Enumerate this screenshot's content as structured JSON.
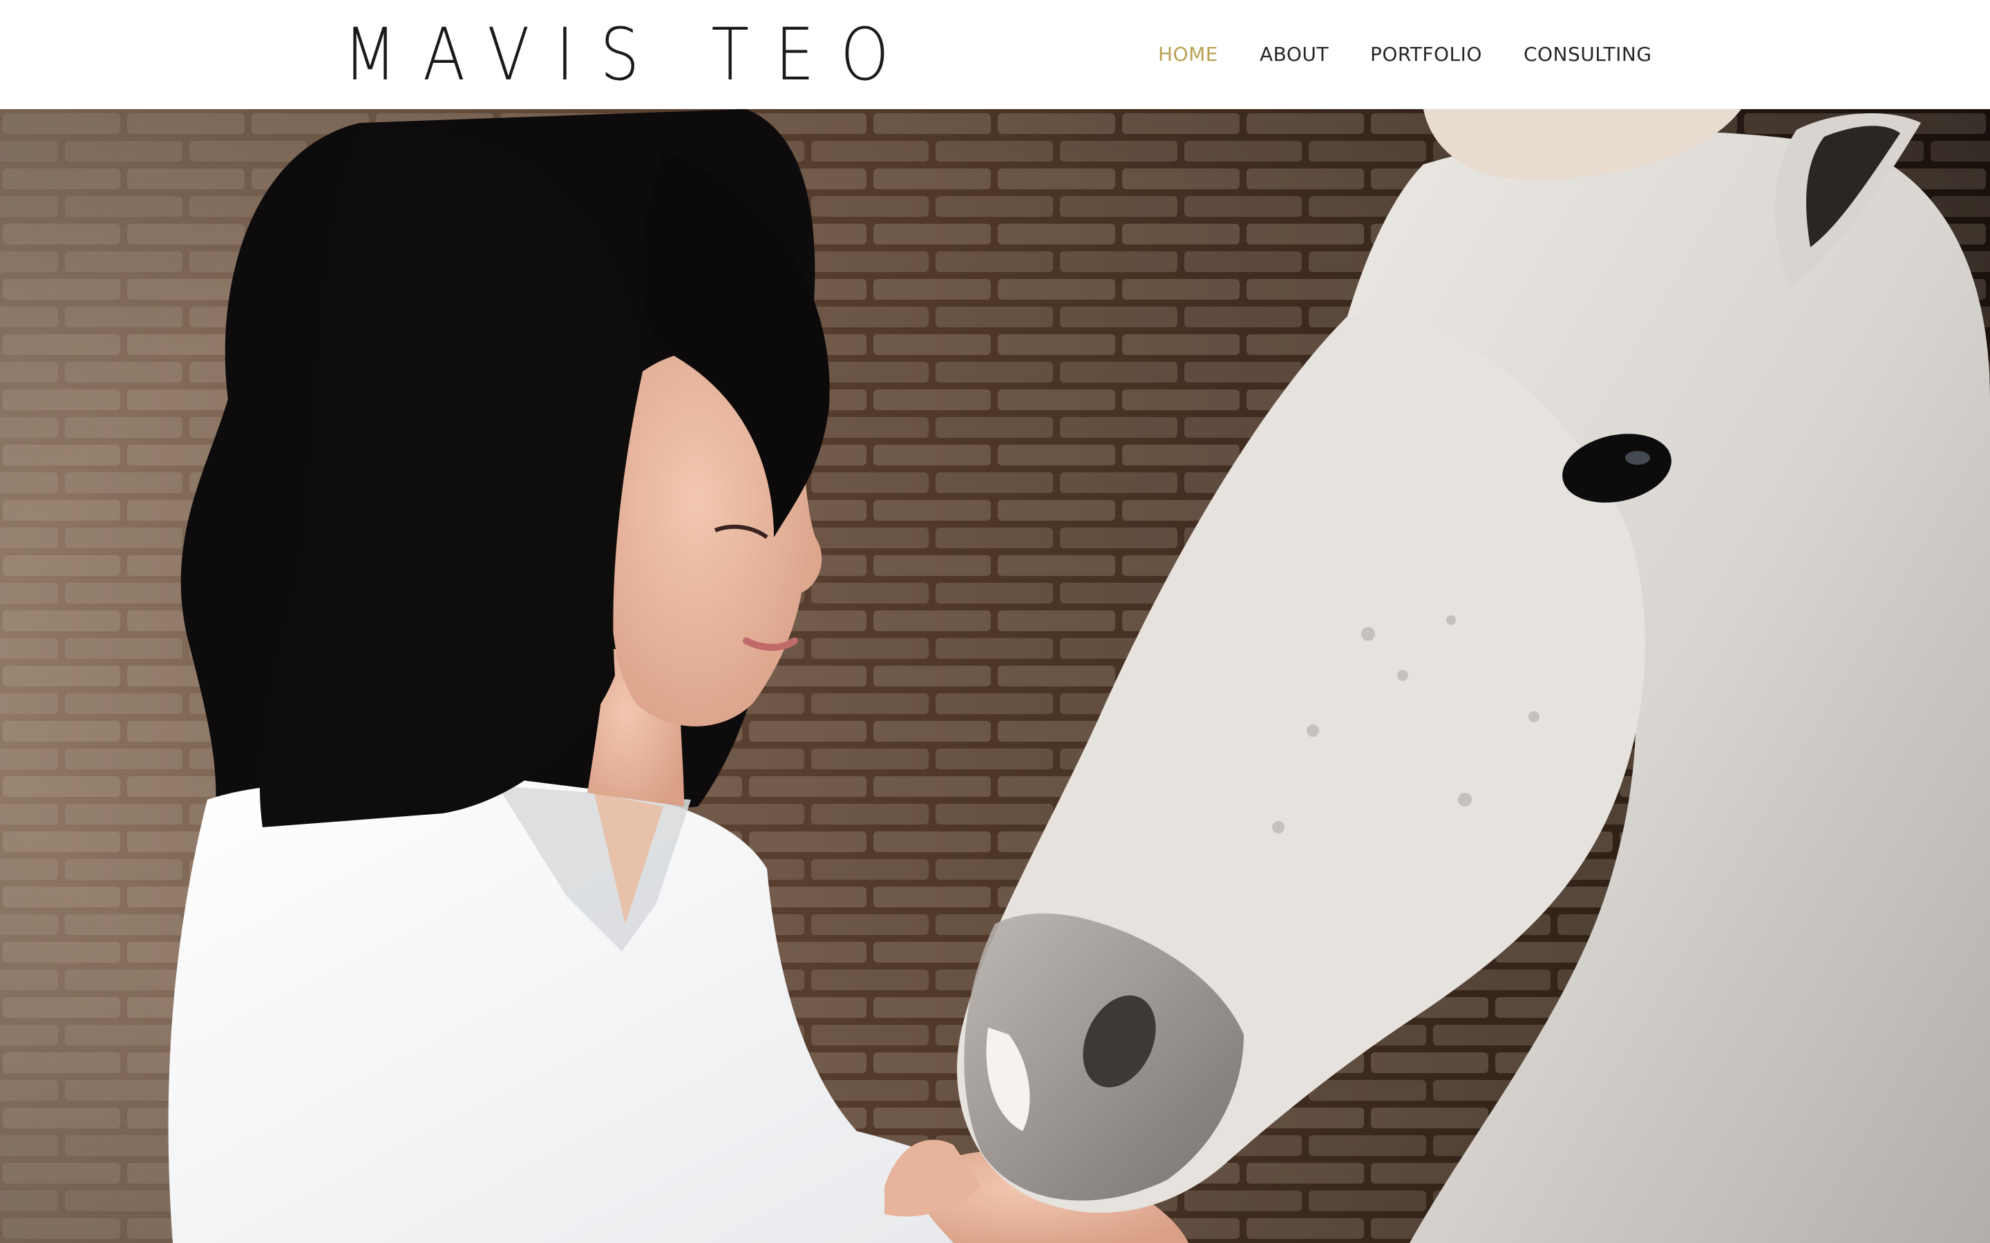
{
  "site": {
    "title": "MAVIS TEO"
  },
  "nav": {
    "items": [
      {
        "label": "HOME",
        "active": true
      },
      {
        "label": "ABOUT",
        "active": false
      },
      {
        "label": "PORTFOLIO",
        "active": false
      },
      {
        "label": "CONSULTING",
        "active": false
      }
    ]
  },
  "colors": {
    "accent": "#b8a052",
    "nav_text": "#262626",
    "logo_text": "#1a1a1a",
    "background": "#ffffff"
  },
  "hero": {
    "image_subject": "woman in white shirt with white horse in front of brick wall"
  }
}
